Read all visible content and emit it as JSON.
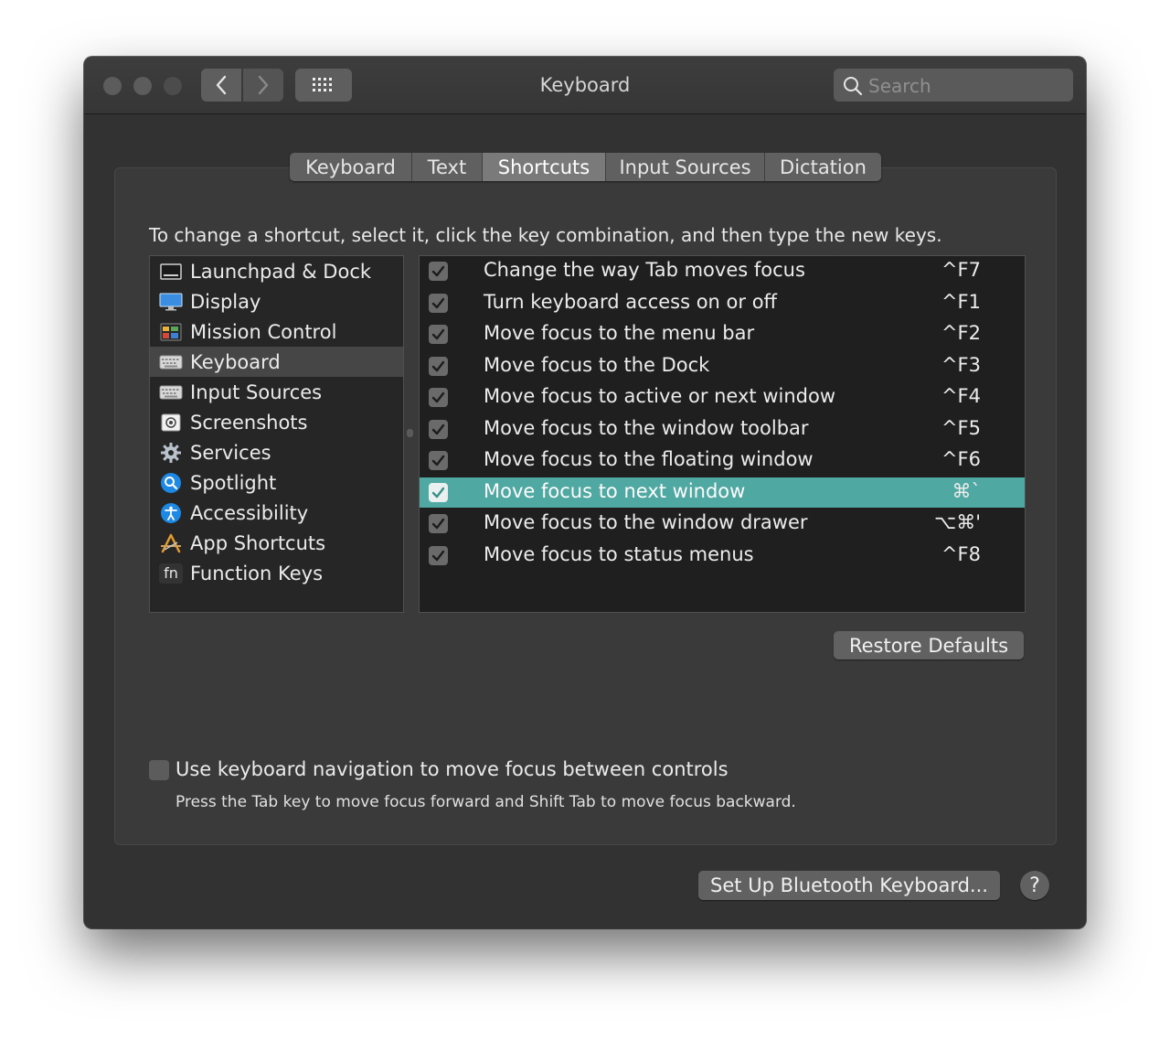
{
  "window": {
    "title": "Keyboard",
    "search": {
      "placeholder": "Search",
      "value": ""
    }
  },
  "tabs": [
    {
      "label": "Keyboard",
      "active": false
    },
    {
      "label": "Text",
      "active": false
    },
    {
      "label": "Shortcuts",
      "active": true
    },
    {
      "label": "Input Sources",
      "active": false
    },
    {
      "label": "Dictation",
      "active": false
    }
  ],
  "instructions": "To change a shortcut, select it, click the key combination, and then type the new keys.",
  "sidebar": {
    "items": [
      {
        "label": "Launchpad & Dock",
        "icon": "launchpad-dock-icon",
        "selected": false
      },
      {
        "label": "Display",
        "icon": "display-icon",
        "selected": false
      },
      {
        "label": "Mission Control",
        "icon": "mission-control-icon",
        "selected": false
      },
      {
        "label": "Keyboard",
        "icon": "keyboard-icon",
        "selected": true
      },
      {
        "label": "Input Sources",
        "icon": "input-sources-icon",
        "selected": false
      },
      {
        "label": "Screenshots",
        "icon": "screenshots-icon",
        "selected": false
      },
      {
        "label": "Services",
        "icon": "services-gear-icon",
        "selected": false
      },
      {
        "label": "Spotlight",
        "icon": "spotlight-icon",
        "selected": false
      },
      {
        "label": "Accessibility",
        "icon": "accessibility-icon",
        "selected": false
      },
      {
        "label": "App Shortcuts",
        "icon": "app-shortcuts-icon",
        "selected": false
      },
      {
        "label": "Function Keys",
        "icon": "function-keys-icon",
        "fn_text": "fn",
        "selected": false
      }
    ]
  },
  "shortcuts": [
    {
      "name": "Change the way Tab moves focus",
      "key": "^F7",
      "checked": true,
      "selected": false
    },
    {
      "name": "Turn keyboard access on or off",
      "key": "^F1",
      "checked": true,
      "selected": false
    },
    {
      "name": "Move focus to the menu bar",
      "key": "^F2",
      "checked": true,
      "selected": false
    },
    {
      "name": "Move focus to the Dock",
      "key": "^F3",
      "checked": true,
      "selected": false
    },
    {
      "name": "Move focus to active or next window",
      "key": "^F4",
      "checked": true,
      "selected": false
    },
    {
      "name": "Move focus to the window toolbar",
      "key": "^F5",
      "checked": true,
      "selected": false
    },
    {
      "name": "Move focus to the floating window",
      "key": "^F6",
      "checked": true,
      "selected": false
    },
    {
      "name": "Move focus to next window",
      "key": "⌘`",
      "checked": true,
      "selected": true
    },
    {
      "name": "Move focus to the window drawer",
      "key": "⌥⌘'",
      "checked": true,
      "selected": false
    },
    {
      "name": "Move focus to status menus",
      "key": "^F8",
      "checked": true,
      "selected": false
    }
  ],
  "buttons": {
    "restore_defaults": "Restore Defaults",
    "bluetooth_setup": "Set Up Bluetooth Keyboard...",
    "help": "?"
  },
  "keyboard_navigation": {
    "label": "Use keyboard navigation to move focus between controls",
    "checked": false,
    "hint": "Press the Tab key to move focus forward and Shift Tab to move focus backward."
  },
  "colors": {
    "selection_accent": "#4fa8a2",
    "window_background": "#323232"
  }
}
